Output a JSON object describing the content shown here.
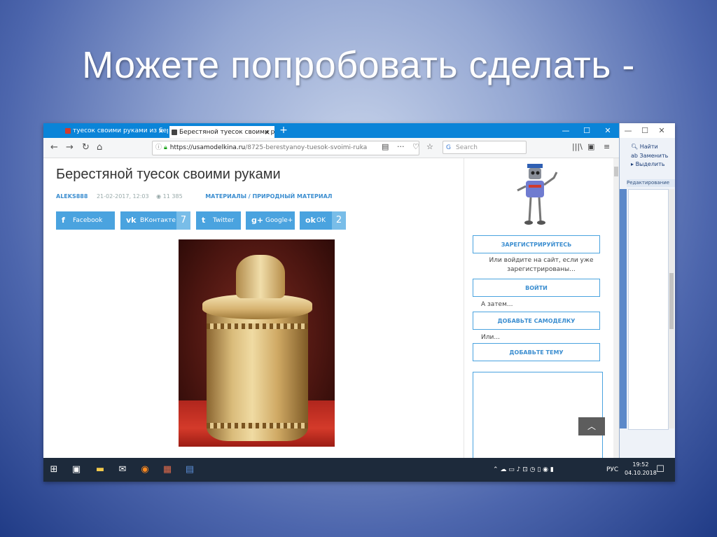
{
  "slide": {
    "title": "Можете попробовать сделать -"
  },
  "browser": {
    "tabs": [
      {
        "label": "туесок своими руками из бер",
        "close": "×"
      },
      {
        "label": "Берестяной туесок своими р",
        "close": "×"
      }
    ],
    "new_tab": "+",
    "window_controls": [
      "—",
      "☐",
      "✕"
    ],
    "nav": {
      "back": "←",
      "forward": "→",
      "reload": "↻",
      "home": "⌂"
    },
    "url": {
      "host": "https://usamodelkina.ru",
      "path": "/8725-berestyanoy-tuesok-svoimi-ruka"
    },
    "url_icons": [
      "▤",
      "···",
      "♡",
      "☆"
    ],
    "search": {
      "placeholder": "Search"
    },
    "toolbar_icons": [
      "|||\\",
      "▣",
      "≡"
    ]
  },
  "article": {
    "title": "Берестяной туесок своими руками",
    "author": "ALEKS888",
    "date": "21-02-2017, 12:03",
    "views": "◉ 11 385",
    "category": "МАТЕРИАЛЫ / ПРИРОДНЫЙ МАТЕРИАЛ",
    "share": [
      {
        "icon": "f",
        "label": "Facebook",
        "count": ""
      },
      {
        "icon": "vk",
        "label": "ВКонтакте",
        "count": "7"
      },
      {
        "icon": "t",
        "label": "Twitter",
        "count": ""
      },
      {
        "icon": "g+",
        "label": "Google+",
        "count": ""
      },
      {
        "icon": "ok",
        "label": "OK",
        "count": "2"
      }
    ]
  },
  "sidebar": {
    "register": "ЗАРЕГИСТРИРУЙТЕСЬ",
    "or_login": "Или войдите на сайт, если уже зарегистрированы...",
    "login": "ВОЙТИ",
    "then": "А затем...",
    "add_craft": "ДОБАВЬТЕ САМОДЕЛКУ",
    "or": "Или...",
    "add_topic": "ДОБАВЬТЕ ТЕМУ",
    "to_top": "︿"
  },
  "word": {
    "controls": [
      "—",
      "☐",
      "✕"
    ],
    "find": "Найти",
    "replace": "Заменить",
    "select": "Выделить",
    "group": "Редактирование"
  },
  "taskbar": {
    "start": "⊞",
    "language": "РУС",
    "time": "19:52",
    "date": "04.10.2018",
    "notification": "☐"
  }
}
